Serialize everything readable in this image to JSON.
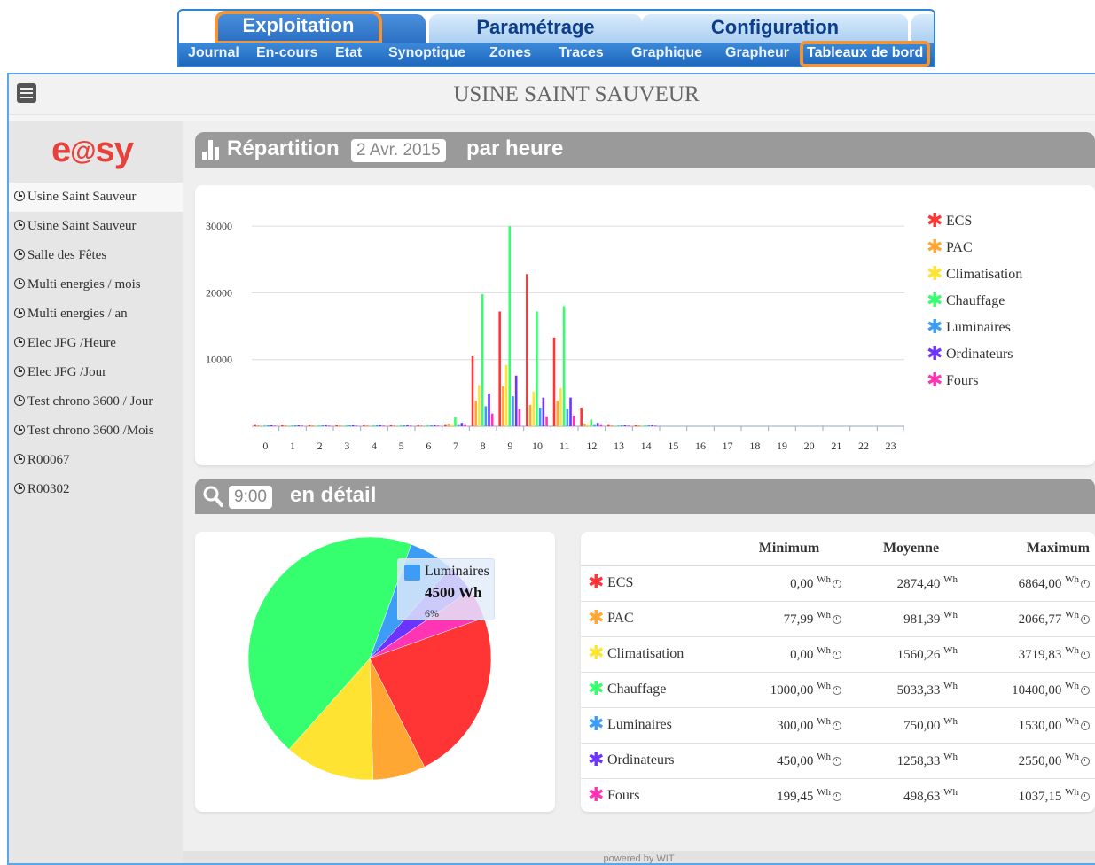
{
  "nav": {
    "top_tabs": [
      {
        "label": "Exploitation",
        "active": true
      },
      {
        "label": "Paramétrage",
        "active": false
      },
      {
        "label": "Configuration",
        "active": false
      }
    ],
    "sub_tabs": [
      {
        "label": "Journal"
      },
      {
        "label": "En-cours"
      },
      {
        "label": "Etat"
      },
      {
        "label": "Synoptique"
      },
      {
        "label": "Zones"
      },
      {
        "label": "Traces"
      },
      {
        "label": "Graphique"
      },
      {
        "label": "Grapheur"
      },
      {
        "label": "Tableaux de bord",
        "active": true
      }
    ],
    "highlight_color": "#f0953a"
  },
  "header": {
    "title": "USINE SAINT SAUVEUR",
    "menu_icon": "menu-icon"
  },
  "sidebar": {
    "logo": "e@sy",
    "items": [
      {
        "label": "Usine Saint Sauveur",
        "selected": true
      },
      {
        "label": "Usine Saint Sauveur"
      },
      {
        "label": "Salle des Fêtes"
      },
      {
        "label": "Multi energies / mois"
      },
      {
        "label": "Multi energies / an"
      },
      {
        "label": "Elec JFG /Heure"
      },
      {
        "label": "Elec JFG /Jour"
      },
      {
        "label": "Test chrono 3600 / Jour"
      },
      {
        "label": "Test chrono 3600 /Mois"
      },
      {
        "label": "R00067"
      },
      {
        "label": "R00302"
      }
    ]
  },
  "section1": {
    "title_left": "Répartition",
    "date": "2 Avr. 2015",
    "title_right": "par heure"
  },
  "section2": {
    "time": "9:00",
    "title_right": "en détail"
  },
  "colors": {
    "ECS": "#ff3535",
    "PAC": "#ffa633",
    "Climatisation": "#ffe333",
    "Chauffage": "#35ff6e",
    "Luminaires": "#3d9cf5",
    "Ordinateurs": "#6b35ff",
    "Fours": "#ff35b4"
  },
  "chart_data": [
    {
      "type": "bar",
      "title": "",
      "xlabel": "",
      "ylabel": "",
      "categories": [
        "0",
        "1",
        "2",
        "3",
        "4",
        "5",
        "6",
        "7",
        "8",
        "9",
        "10",
        "11",
        "12",
        "13",
        "14",
        "15",
        "16",
        "17",
        "18",
        "19",
        "20",
        "21",
        "22",
        "23"
      ],
      "yticks": [
        10000,
        20000,
        30000
      ],
      "ylim": [
        0,
        32000
      ],
      "legend": "right",
      "grid": true,
      "series": [
        {
          "name": "ECS",
          "values": [
            300,
            250,
            250,
            250,
            250,
            250,
            250,
            300,
            10500,
            17200,
            22800,
            13300,
            2800,
            300,
            200,
            0,
            0,
            0,
            0,
            0,
            0,
            0,
            0,
            0
          ]
        },
        {
          "name": "PAC",
          "values": [
            150,
            150,
            150,
            150,
            150,
            150,
            150,
            400,
            3800,
            6000,
            3200,
            3800,
            400,
            150,
            150,
            0,
            0,
            0,
            0,
            0,
            0,
            0,
            0,
            0
          ]
        },
        {
          "name": "Climatisation",
          "values": [
            0,
            0,
            0,
            0,
            0,
            0,
            0,
            300,
            6200,
            9200,
            5200,
            5700,
            300,
            0,
            0,
            0,
            0,
            0,
            0,
            0,
            0,
            0,
            0,
            0
          ]
        },
        {
          "name": "Chauffage",
          "values": [
            200,
            200,
            200,
            200,
            200,
            200,
            200,
            1400,
            19800,
            30000,
            17200,
            18000,
            1000,
            200,
            200,
            0,
            0,
            0,
            0,
            0,
            0,
            0,
            0,
            0
          ]
        },
        {
          "name": "Luminaires",
          "values": [
            150,
            150,
            150,
            150,
            150,
            150,
            150,
            300,
            3000,
            4500,
            2800,
            2600,
            300,
            150,
            150,
            0,
            0,
            0,
            0,
            0,
            0,
            0,
            0,
            0
          ]
        },
        {
          "name": "Ordinateurs",
          "values": [
            200,
            200,
            200,
            200,
            200,
            200,
            200,
            500,
            4900,
            7600,
            4300,
            4300,
            500,
            200,
            200,
            0,
            0,
            0,
            0,
            0,
            0,
            0,
            0,
            0
          ]
        },
        {
          "name": "Fours",
          "values": [
            100,
            100,
            100,
            100,
            100,
            100,
            100,
            300,
            1900,
            2600,
            1500,
            1600,
            300,
            100,
            100,
            0,
            0,
            0,
            0,
            0,
            0,
            0,
            0,
            0
          ]
        }
      ]
    },
    {
      "type": "pie",
      "title": "",
      "labels": [
        "Luminaires",
        "Ordinateurs",
        "Fours",
        "ECS",
        "PAC",
        "Climatisation",
        "Chauffage"
      ],
      "values": [
        6,
        4,
        4,
        23,
        7,
        12,
        44
      ],
      "tooltip": {
        "name": "Luminaires",
        "value": "4500 Wh",
        "percent": "6%"
      }
    }
  ],
  "stats": {
    "headers": [
      "",
      "Minimum",
      "Moyenne",
      "Maximum"
    ],
    "unit": "Wh",
    "rows": [
      {
        "name": "ECS",
        "min": "0,00",
        "avg": "2874,40",
        "max": "6864,00"
      },
      {
        "name": "PAC",
        "min": "77,99",
        "avg": "981,39",
        "max": "2066,77"
      },
      {
        "name": "Climatisation",
        "min": "0,00",
        "avg": "1560,26",
        "max": "3719,83"
      },
      {
        "name": "Chauffage",
        "min": "1000,00",
        "avg": "5033,33",
        "max": "10400,00"
      },
      {
        "name": "Luminaires",
        "min": "300,00",
        "avg": "750,00",
        "max": "1530,00"
      },
      {
        "name": "Ordinateurs",
        "min": "450,00",
        "avg": "1258,33",
        "max": "2550,00"
      },
      {
        "name": "Fours",
        "min": "199,45",
        "avg": "498,63",
        "max": "1037,15"
      }
    ]
  },
  "footer": {
    "text": "powered by WIT"
  }
}
